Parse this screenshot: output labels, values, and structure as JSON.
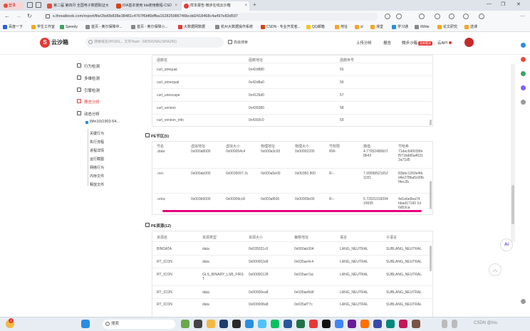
{
  "browser": {
    "profile_label": "登录",
    "tabs": [
      {
        "label": "第二届 第四月 全国电子数据取证大",
        "active": false,
        "color": "#e74c3c"
      },
      {
        "label": "IDA基本使用 Ida使用教程-CSD",
        "active": false,
        "color": "#d84315"
      },
      {
        "label": "样本报告-微步在线云沙箱",
        "active": true,
        "color": "#e53935"
      }
    ],
    "url": "s.threatbook.com/report/file/2bd0b838e38481c4767f6bf6bffba162825986746bcdd2418468c4a497e83d597",
    "bookmarks": [
      "百度一下",
      "学生工作室",
      "Speedy",
      "首页 - 奥尔保障中...",
      "首页 - 奥尔保障小...",
      "大数据网数据",
      "杭州大数据操作系统",
      "CSDN - 专业开发者...",
      "QQ邮箱",
      "地址",
      "sl",
      "滑堂",
      "学习通",
      "iWrite",
      "论文研究",
      "选课"
    ]
  },
  "site": {
    "logo": "云沙箱",
    "search_placeholder": "搜索域名/IP/URL，文件Hash（MD5/SHA1/SHA256)",
    "advanced_search": "高级搜索",
    "nav": [
      {
        "label": "上传分析",
        "red": false
      },
      {
        "label": "报告",
        "red": false
      },
      {
        "label": "微步沙箱",
        "red": false,
        "badge": "全新版本"
      },
      {
        "label": "云API",
        "red": false,
        "dot": true
      }
    ]
  },
  "sidebar": {
    "items": [
      {
        "label": "行为检测",
        "active": false
      },
      {
        "label": "多维检测",
        "active": false
      },
      {
        "label": "引擎检测",
        "active": false
      },
      {
        "label": "静态分析",
        "active": true
      },
      {
        "label": "动态分析",
        "active": false
      }
    ],
    "env": "Win10(1903 64...",
    "subitems": [
      "关键行为",
      "执行流程",
      "进程详情",
      "运行截图",
      "网络行为",
      "内存文件",
      "释放文件"
    ]
  },
  "imports": {
    "headers": [
      "函数名",
      "函数地址",
      "函数序号"
    ],
    "rows": [
      [
        "curl_strequal",
        "0x42d880",
        "55"
      ],
      [
        "curl_strnequal",
        "0x42d8a0",
        "56"
      ],
      [
        "curl_unescape",
        "0x4126d0",
        "57"
      ],
      [
        "curl_version",
        "0x439380",
        "58"
      ],
      [
        "curl_version_info",
        "0x4393c0",
        "59"
      ]
    ]
  },
  "sections": {
    "title": "PE节区(5)",
    "headers": [
      "节名",
      "虚拟地址",
      "虚拟大小",
      "物理地址",
      "物理大小",
      "节权限",
      "熵值",
      "节哈希"
    ],
    "rows": [
      [
        ".data",
        "0x000a8000",
        "0x000054c4",
        "0x000a3c00",
        "0x00002200",
        "RW-",
        "4.77052480607 8643",
        "71dec649039fe f571bdd6a4031 2a71d5"
      ],
      [
        ".rsrc",
        "0x000ab000",
        "0x0035097 2c",
        "0x000a5e00",
        "0x00350 800",
        "R--",
        "7.99998521652 1181",
        "83bbc1269ef4b d4e278ba5c09b f4ec2b"
      ],
      [
        ".reloc",
        "0x003b5000",
        "0x00009cc8",
        "0x003af600",
        "0x00009e00",
        "R--",
        "5.72021016094 15695",
        "4d1ebe8ea74 bbad17160 1d 6d53ca"
      ]
    ]
  },
  "resources": {
    "title": "PE资源(12)",
    "headers": [
      "资源名",
      "资源类型",
      "资源大小",
      "偏移地址",
      "语言",
      "子语言"
    ],
    "rows": [
      [
        "BINDATA",
        "data",
        "0x035031c0",
        "0x000ab304",
        "LANG_NEUTRAL",
        "SUBLANG_NEUTRAL"
      ],
      [
        "RT_ICON",
        "data",
        "0x000002e8",
        "0x035ae4c4",
        "LANG_NEUTRAL",
        "SUBLANG_NEUTRAL"
      ],
      [
        "RT_ICON",
        "GLS_BINARY_LSB_FIRST",
        "0x00000128",
        "0x035ae7ac",
        "LANG_NEUTRAL",
        "SUBLANG_NEUTRAL"
      ],
      [
        "RT_ICON",
        "data",
        "0x00000ea8",
        "0x035ae8d4",
        "LANG_NEUTRAL",
        "SUBLANG_NEUTRAL"
      ],
      [
        "RT_ICON",
        "data",
        "0x000008a8",
        "0x035af77c",
        "LANG_NEUTRAL",
        "SUBLANG_NEUTRAL"
      ]
    ]
  },
  "floating": {
    "ai_label": "Ai",
    "top_label": "︿"
  },
  "taskbar": {
    "search_label": "搜索",
    "weather_badge": "2",
    "watermark": "CSDN @Iriu"
  }
}
